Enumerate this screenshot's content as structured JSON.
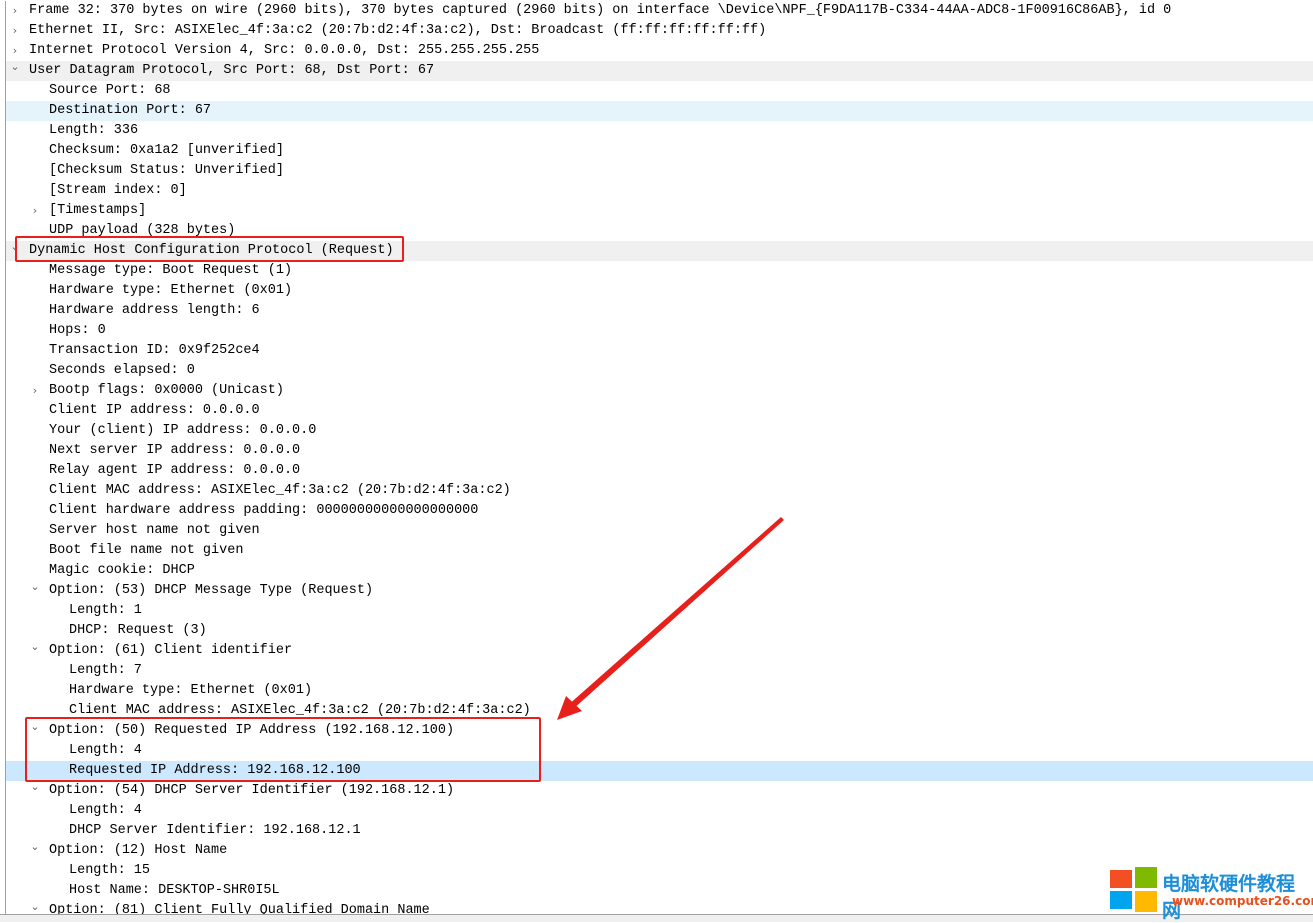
{
  "rows": [
    {
      "level": 0,
      "expand": "collapsed",
      "text": "Frame 32: 370 bytes on wire (2960 bits), 370 bytes captured (2960 bits) on interface \\Device\\NPF_{F9DA117B-C334-44AA-ADC8-1F00916C86AB}, id 0"
    },
    {
      "level": 0,
      "expand": "collapsed",
      "text": "Ethernet II, Src: ASIXElec_4f:3a:c2 (20:7b:d2:4f:3a:c2), Dst: Broadcast (ff:ff:ff:ff:ff:ff)"
    },
    {
      "level": 0,
      "expand": "collapsed",
      "text": "Internet Protocol Version 4, Src: 0.0.0.0, Dst: 255.255.255.255"
    },
    {
      "level": 0,
      "expand": "expanded",
      "text": "User Datagram Protocol, Src Port: 68, Dst Port: 67",
      "state": "hdr"
    },
    {
      "level": 1,
      "text": "Source Port: 68"
    },
    {
      "level": 1,
      "text": "Destination Port: 67",
      "state": "hover"
    },
    {
      "level": 1,
      "text": "Length: 336"
    },
    {
      "level": 1,
      "text": "Checksum: 0xa1a2 [unverified]"
    },
    {
      "level": 1,
      "text": "[Checksum Status: Unverified]"
    },
    {
      "level": 1,
      "text": "[Stream index: 0]"
    },
    {
      "level": 1,
      "expand": "collapsed",
      "text": "[Timestamps]"
    },
    {
      "level": 1,
      "text": "UDP payload (328 bytes)"
    },
    {
      "level": 0,
      "expand": "expanded",
      "text": "Dynamic Host Configuration Protocol (Request)",
      "state": "hdr"
    },
    {
      "level": 1,
      "text": "Message type: Boot Request (1)"
    },
    {
      "level": 1,
      "text": "Hardware type: Ethernet (0x01)"
    },
    {
      "level": 1,
      "text": "Hardware address length: 6"
    },
    {
      "level": 1,
      "text": "Hops: 0"
    },
    {
      "level": 1,
      "text": "Transaction ID: 0x9f252ce4"
    },
    {
      "level": 1,
      "text": "Seconds elapsed: 0"
    },
    {
      "level": 1,
      "expand": "collapsed",
      "text": "Bootp flags: 0x0000 (Unicast)"
    },
    {
      "level": 1,
      "text": "Client IP address: 0.0.0.0"
    },
    {
      "level": 1,
      "text": "Your (client) IP address: 0.0.0.0"
    },
    {
      "level": 1,
      "text": "Next server IP address: 0.0.0.0"
    },
    {
      "level": 1,
      "text": "Relay agent IP address: 0.0.0.0"
    },
    {
      "level": 1,
      "text": "Client MAC address: ASIXElec_4f:3a:c2 (20:7b:d2:4f:3a:c2)"
    },
    {
      "level": 1,
      "text": "Client hardware address padding: 00000000000000000000"
    },
    {
      "level": 1,
      "text": "Server host name not given"
    },
    {
      "level": 1,
      "text": "Boot file name not given"
    },
    {
      "level": 1,
      "text": "Magic cookie: DHCP"
    },
    {
      "level": 1,
      "expand": "expanded",
      "text": "Option: (53) DHCP Message Type (Request)"
    },
    {
      "level": 2,
      "text": "Length: 1"
    },
    {
      "level": 2,
      "text": "DHCP: Request (3)"
    },
    {
      "level": 1,
      "expand": "expanded",
      "text": "Option: (61) Client identifier"
    },
    {
      "level": 2,
      "text": "Length: 7"
    },
    {
      "level": 2,
      "text": "Hardware type: Ethernet (0x01)"
    },
    {
      "level": 2,
      "text": "Client MAC address: ASIXElec_4f:3a:c2 (20:7b:d2:4f:3a:c2)"
    },
    {
      "level": 1,
      "expand": "expanded",
      "text": "Option: (50) Requested IP Address (192.168.12.100)"
    },
    {
      "level": 2,
      "text": "Length: 4"
    },
    {
      "level": 2,
      "text": "Requested IP Address: 192.168.12.100",
      "state": "sel"
    },
    {
      "level": 1,
      "expand": "expanded",
      "text": "Option: (54) DHCP Server Identifier (192.168.12.1)"
    },
    {
      "level": 2,
      "text": "Length: 4"
    },
    {
      "level": 2,
      "text": "DHCP Server Identifier: 192.168.12.1"
    },
    {
      "level": 1,
      "expand": "expanded",
      "text": "Option: (12) Host Name"
    },
    {
      "level": 2,
      "text": "Length: 15"
    },
    {
      "level": 2,
      "text": "Host Name: DESKTOP-SHR0I5L"
    },
    {
      "level": 1,
      "expand": "expanded",
      "text": "Option: (81) Client Fully Qualified Domain Name"
    }
  ],
  "annotation_color": "#e8201c",
  "watermark": {
    "title": "电脑软硬件教程网",
    "url": "www.computer26.com",
    "title_color": "#1e8fd6",
    "url_color": "#e8501c"
  }
}
